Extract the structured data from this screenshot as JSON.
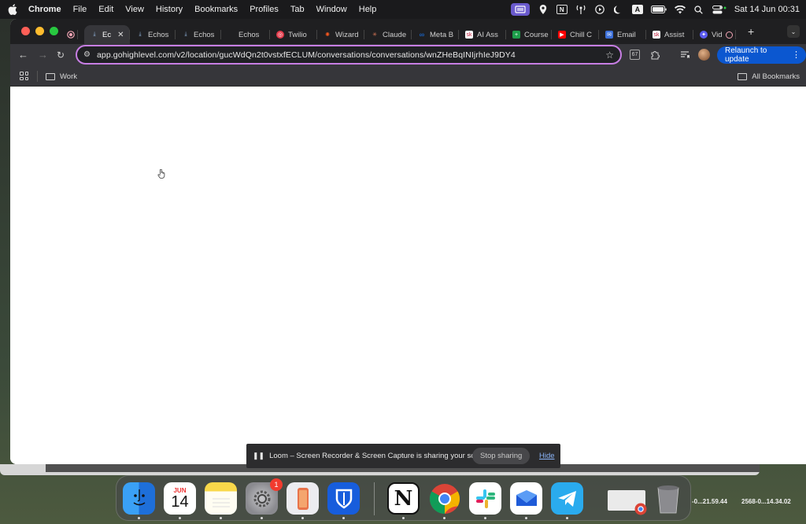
{
  "menubar": {
    "app_name": "Chrome",
    "items": [
      "File",
      "Edit",
      "View",
      "History",
      "Bookmarks",
      "Profiles",
      "Tab",
      "Window",
      "Help"
    ],
    "status_icons": [
      "screen-share-icon",
      "location-icon",
      "notion-icon",
      "antenna-icon",
      "play-icon",
      "moon-icon",
      "keyboard-input-icon",
      "battery-icon",
      "wifi-icon",
      "search-icon",
      "control-center-icon"
    ],
    "input_source": "A",
    "notion_letter": "N",
    "clock": "Sat 14 Jun  00:31"
  },
  "tabs": [
    {
      "label": "Ec",
      "active": true,
      "favicon_color": "#4a90d9"
    },
    {
      "label": "Echos",
      "active": false,
      "favicon_color": "#4a90d9"
    },
    {
      "label": "Echos",
      "active": false,
      "favicon_color": "#4a90d9"
    },
    {
      "label": "Echos",
      "active": false,
      "favicon_color": "#888888"
    },
    {
      "label": "Twilio",
      "active": false,
      "favicon_color": "#e33b4b"
    },
    {
      "label": "Wizard",
      "active": false,
      "favicon_color": "#ff5a1f"
    },
    {
      "label": "Claude",
      "active": false,
      "favicon_color": "#d97757"
    },
    {
      "label": "Meta B",
      "active": false,
      "favicon_color": "#1877f2"
    },
    {
      "label": "AI Ass",
      "active": false,
      "favicon_color": "#c21d3b"
    },
    {
      "label": "Course",
      "active": false,
      "favicon_color": "#1e9e4b"
    },
    {
      "label": "Chill C",
      "active": false,
      "favicon_color": "#ff0000"
    },
    {
      "label": "Email",
      "active": false,
      "favicon_color": "#3b6fd9"
    },
    {
      "label": "Assist",
      "active": false,
      "favicon_color": "#c21d3b"
    },
    {
      "label": "Vid",
      "active": false,
      "favicon_color": "#5b5bf0"
    }
  ],
  "first_tab_close": "✕",
  "new_tab_label": "+",
  "omnibox": {
    "url": "app.gohighlevel.com/v2/location/gucWdQn2t0vstxfECLUM/conversations/conversations/wnZHeBqINIjrhIeJ9DY4"
  },
  "relaunch_label": "Relaunch to update",
  "bookmarks": {
    "items": [
      {
        "label": "Work"
      }
    ],
    "all_label": "All Bookmarks"
  },
  "loom": {
    "message": "Loom – Screen Recorder & Screen Capture is sharing your screen.",
    "stop_label": "Stop sharing",
    "hide_label": "Hide"
  },
  "dock": {
    "calendar_month": "JUN",
    "calendar_day": "14",
    "settings_badge": "1",
    "notion_letter": "N",
    "apps": [
      "finder",
      "calendar",
      "notes",
      "system-settings",
      "iphone-mirroring",
      "bitwarden",
      "notion",
      "chrome",
      "slack",
      "spark-mail",
      "telegram"
    ]
  },
  "desktop_files": [
    "-0...21.59.44",
    "2568-0...14.34.02"
  ]
}
